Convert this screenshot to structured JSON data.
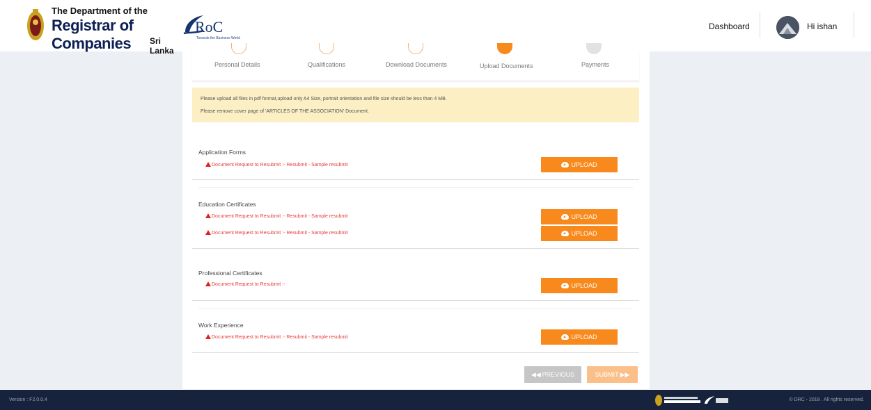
{
  "header": {
    "logo_line1": "The Department of the",
    "logo_line2": "Registrar of Companies",
    "logo_line3": "Sri Lanka",
    "eroc_text": "RoC",
    "eroc_tagline": "Towards the Business World",
    "nav_dashboard": "Dashboard",
    "user_greeting": "Hi ishan"
  },
  "steps": [
    {
      "label": "Personal Details",
      "state": "done"
    },
    {
      "label": "Qualifications",
      "state": "done"
    },
    {
      "label": "Download Documents",
      "state": "done"
    },
    {
      "label": "Upload Documents",
      "state": "active"
    },
    {
      "label": "Payments",
      "state": "pending"
    }
  ],
  "notice": {
    "line1": "Please upload all files in pdf format,upload only A4 Size, portrait orientation and file size should be less than 4 MB.",
    "line2": "Please remove cover page of 'ARTICLES OF THE ASSOCIATION' Document."
  },
  "sections": [
    {
      "title": "Application Forms",
      "requests": [
        "Document Request to Resubmit :- Resubmit - Sample resubmit"
      ]
    },
    {
      "title": "Education Certificates",
      "requests": [
        "Document Request to Resubmit :- Resubmit - Sample resubmit",
        "Document Request to Resubmit :- Resubmit - Sample resubmit"
      ]
    },
    {
      "title": "Professional Certificates",
      "requests": [
        "Document Request to Resubmit :-"
      ]
    },
    {
      "title": "Work Experience",
      "requests": [
        "Document Request to Resubmit :- Resubmit - Sample resubmit"
      ]
    }
  ],
  "upload_label": "UPLOAD",
  "buttons": {
    "previous": "PREVIOUS",
    "submit": "SUBMIT"
  },
  "footer": {
    "version": "Version : F2.0.0.4",
    "copyright": "© DRC - 2018 . All rights reserved."
  },
  "colors": {
    "accent": "#f8891c",
    "error": "#e43c3c",
    "footer_bg": "#17223d",
    "notice_bg": "#fcefc4"
  }
}
